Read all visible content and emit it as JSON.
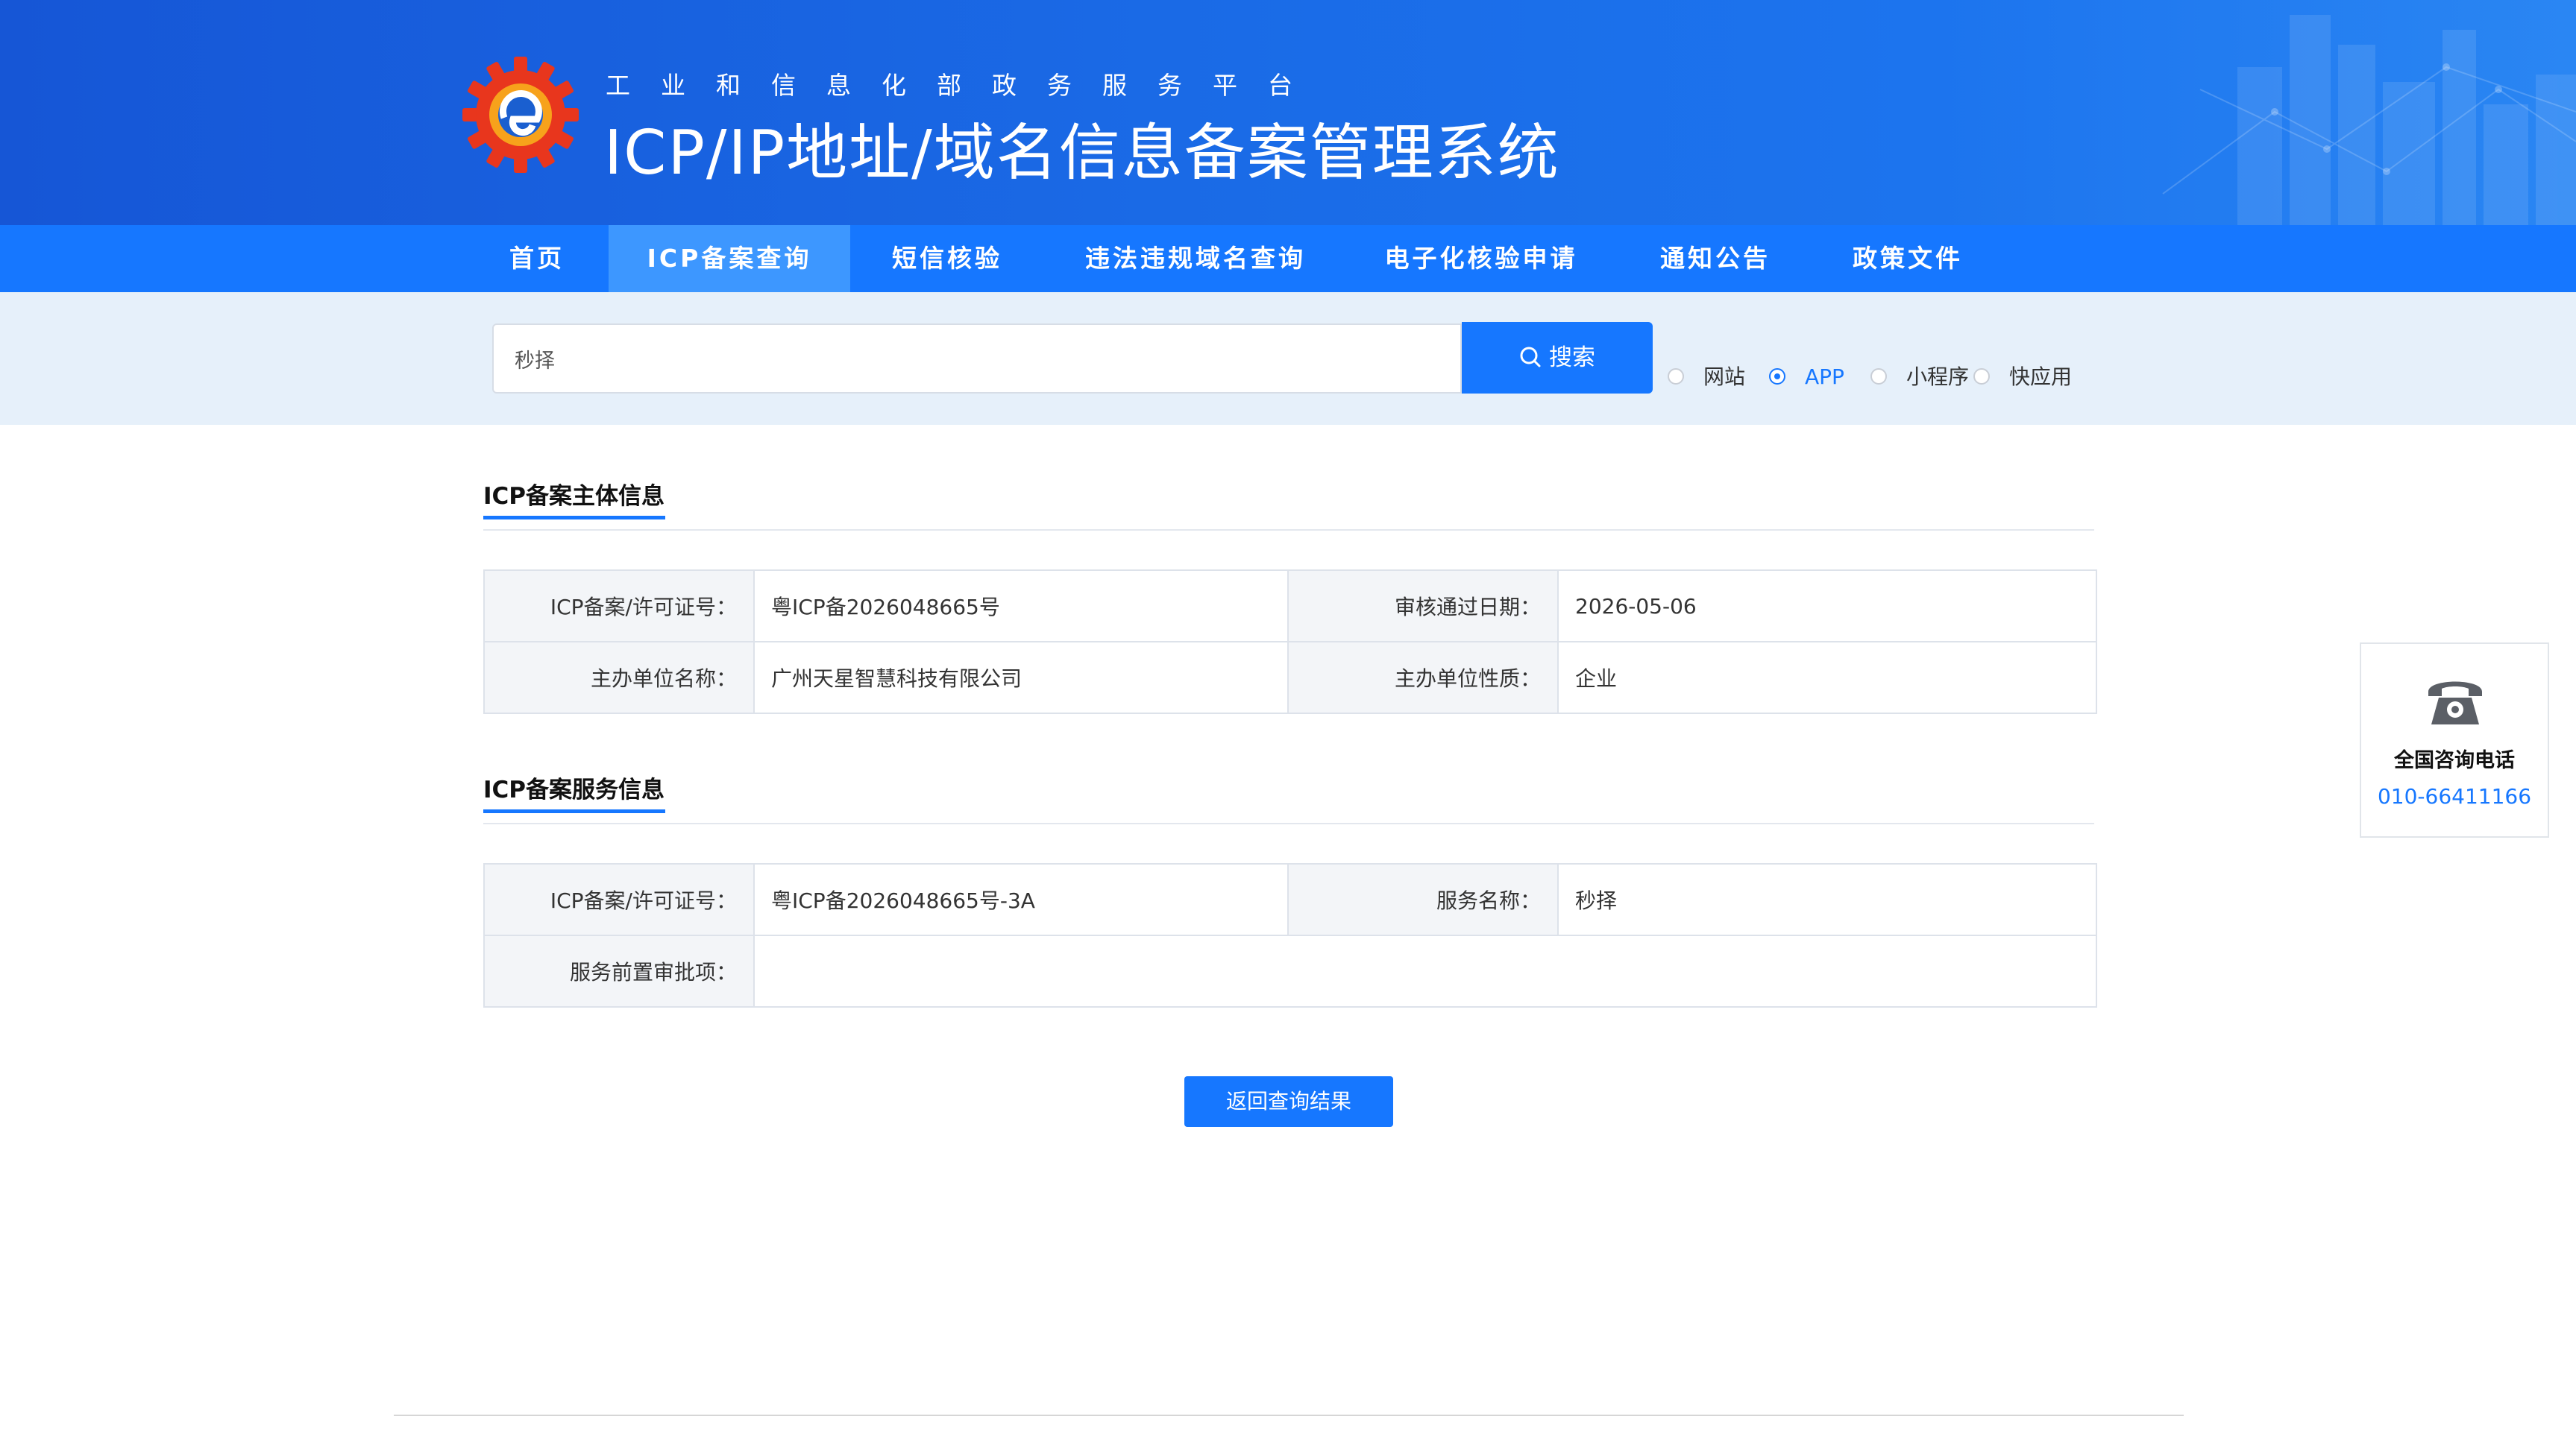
{
  "header": {
    "subtitle": "工业和信息化部政务服务平台",
    "title": "ICP/IP地址/域名信息备案管理系统",
    "logo_icon": "gear-logo-icon"
  },
  "nav": {
    "items": [
      {
        "label": "首页",
        "active": false
      },
      {
        "label": "ICP备案查询",
        "active": true
      },
      {
        "label": "短信核验",
        "active": false
      },
      {
        "label": "违法违规域名查询",
        "active": false
      },
      {
        "label": "电子化核验申请",
        "active": false
      },
      {
        "label": "通知公告",
        "active": false
      },
      {
        "label": "政策文件",
        "active": false
      }
    ]
  },
  "search": {
    "value": "秒择",
    "button_label": "搜索",
    "options": [
      {
        "label": "网站",
        "checked": false
      },
      {
        "label": "APP",
        "checked": true
      },
      {
        "label": "小程序",
        "checked": false
      },
      {
        "label": "快应用",
        "checked": false
      }
    ]
  },
  "subject_info": {
    "title": "ICP备案主体信息",
    "rows": [
      {
        "label1": "ICP备案/许可证号：",
        "value1": "粤ICP备2026048665号",
        "label2": "审核通过日期：",
        "value2": "2026-05-06"
      },
      {
        "label1": "主办单位名称：",
        "value1": "广州天星智慧科技有限公司",
        "label2": "主办单位性质：",
        "value2": "企业"
      }
    ]
  },
  "service_info": {
    "title": "ICP备案服务信息",
    "rows": [
      {
        "label1": "ICP备案/许可证号：",
        "value1": "粤ICP备2026048665号-3A",
        "label2": "服务名称：",
        "value2": "秒择"
      },
      {
        "label1": "服务前置审批项：",
        "value1": ""
      }
    ]
  },
  "back_button": "返回查询结果",
  "consult": {
    "title": "全国咨询电话",
    "number": "010-66411166",
    "icon": "telephone-icon"
  },
  "colors": {
    "brand_blue": "#1677ff",
    "banner_blue": "#1a6ae6",
    "nav_active": "#3d97ff",
    "search_band": "#e6f0fa"
  }
}
